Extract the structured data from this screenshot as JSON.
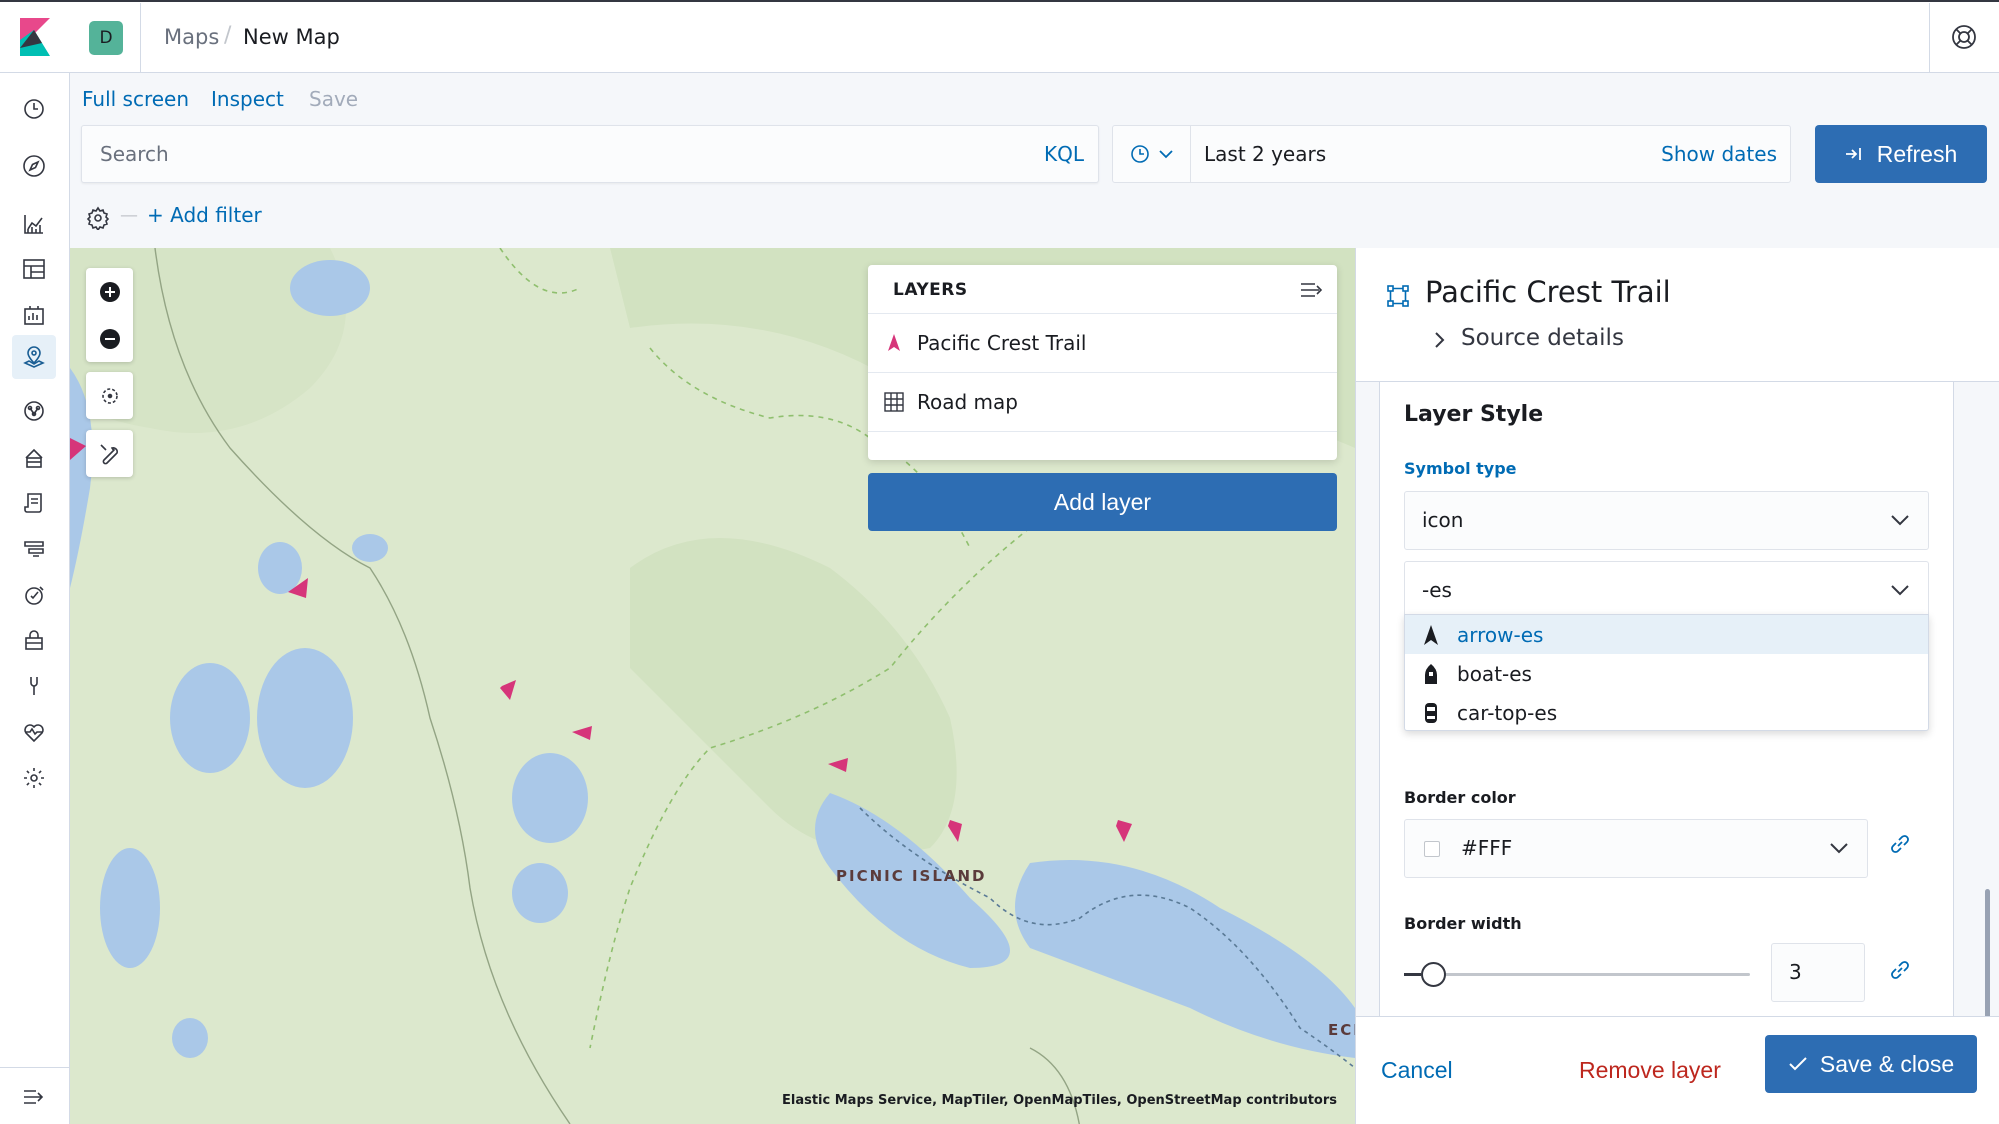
{
  "header": {
    "space_letter": "D",
    "breadcrumbs": [
      "Maps",
      "New Map"
    ],
    "breadcrumb_separator": "/"
  },
  "nav": {
    "items": [
      "clock-icon",
      "compass-icon",
      "visualize-icon",
      "dashboard-icon",
      "canvas-icon",
      "maps-icon",
      "ml-icon",
      "infrastructure-icon",
      "logs-icon",
      "apm-icon",
      "uptime-icon",
      "siem-icon",
      "devtools-icon",
      "monitoring-icon",
      "management-icon"
    ],
    "collapse_icon": "collapse-nav-icon"
  },
  "menu": {
    "full_screen": "Full screen",
    "inspect": "Inspect",
    "save": "Save"
  },
  "query": {
    "placeholder": "Search",
    "language": "KQL"
  },
  "time": {
    "range": "Last 2 years",
    "show_dates": "Show dates",
    "refresh": "Refresh"
  },
  "filters": {
    "dash": "—",
    "add_filter": "+ Add filter"
  },
  "map": {
    "attribution": "Elastic Maps Service, MapTiler, OpenMapTiles, OpenStreetMap contributors",
    "labels": [
      "PICNIC ISLAND",
      "ECI"
    ],
    "colors": {
      "land": "#dce8cd",
      "water": "#aac8e8",
      "marker": "#d6357a"
    }
  },
  "layers": {
    "title": "LAYERS",
    "items": [
      {
        "name": "Pacific Crest Trail",
        "icon": "arrow-marker-icon"
      },
      {
        "name": "Road map",
        "icon": "grid-icon"
      }
    ],
    "add_layer": "Add layer"
  },
  "panel": {
    "title": "Pacific Crest Trail",
    "source_details": "Source details",
    "section_title": "Layer Style",
    "symbol_type_label": "Symbol type",
    "symbol_type_value": "icon",
    "icon_search_value": "-es",
    "icon_options": [
      "arrow-es",
      "boat-es",
      "car-top-es"
    ],
    "border_color_label": "Border color",
    "border_color_value": "#FFF",
    "border_width_label": "Border width",
    "border_width_value": "3",
    "border_width_fraction": 0.05,
    "cancel": "Cancel",
    "remove_layer": "Remove layer",
    "save_close": "Save & close"
  }
}
